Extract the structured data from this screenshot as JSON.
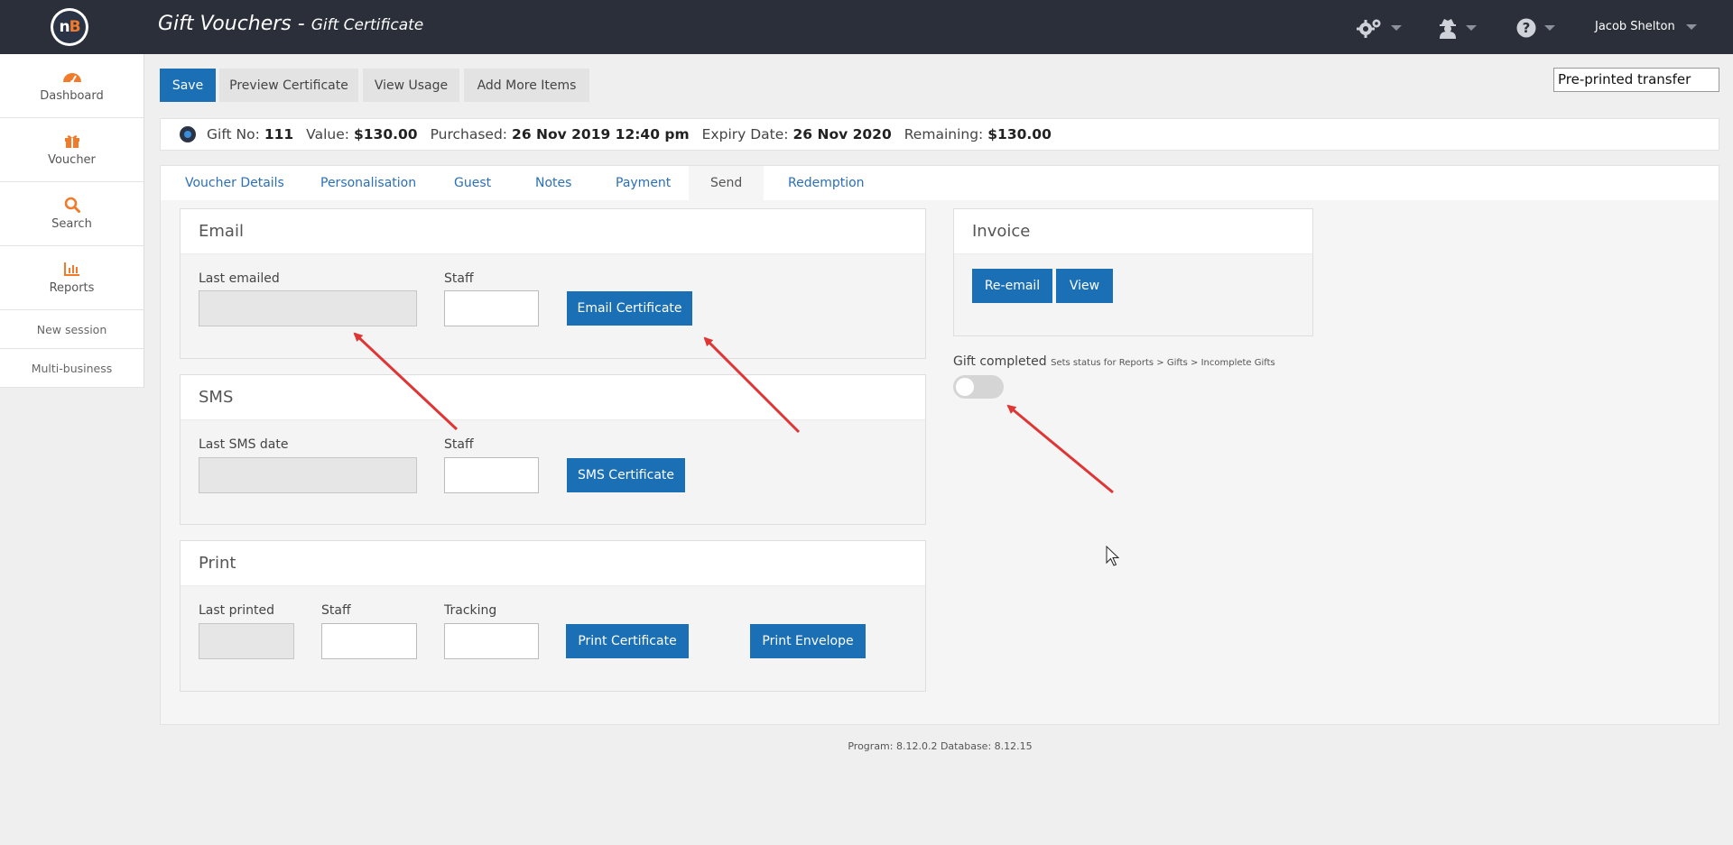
{
  "header": {
    "logo_text": "nB",
    "title": "Gift Vouchers",
    "separator": " - ",
    "subtitle": "Gift Certificate",
    "user_name": "Jacob Shelton"
  },
  "sidebar": {
    "items": [
      {
        "label": "Dashboard",
        "icon": "dashboard-icon"
      },
      {
        "label": "Voucher",
        "icon": "gift-icon"
      },
      {
        "label": "Search",
        "icon": "search-icon"
      },
      {
        "label": "Reports",
        "icon": "bar-chart-icon"
      }
    ],
    "links": [
      "New session",
      "Multi-business"
    ]
  },
  "toolbar": {
    "save": "Save",
    "preview": "Preview Certificate",
    "usage": "View Usage",
    "add_items": "Add More Items",
    "delivery_select": "Pre-printed transfer"
  },
  "info": {
    "gift_no_label": "Gift No:",
    "gift_no": "111",
    "value_label": "Value:",
    "value": "$130.00",
    "purchased_label": "Purchased:",
    "purchased": "26 Nov 2019 12:40 pm",
    "expiry_label": "Expiry Date:",
    "expiry": "26 Nov 2020",
    "remaining_label": "Remaining:",
    "remaining": "$130.00"
  },
  "tabs": [
    "Voucher Details",
    "Personalisation",
    "Guest",
    "Notes",
    "Payment",
    "Send",
    "Redemption"
  ],
  "active_tab": "Send",
  "email": {
    "title": "Email",
    "last_label": "Last emailed",
    "last_value": "",
    "staff_label": "Staff",
    "staff_value": "",
    "button": "Email Certificate"
  },
  "sms": {
    "title": "SMS",
    "last_label": "Last SMS date",
    "last_value": "",
    "staff_label": "Staff",
    "staff_value": "",
    "button": "SMS Certificate"
  },
  "print": {
    "title": "Print",
    "last_label": "Last printed",
    "staff_label": "Staff",
    "tracking_label": "Tracking",
    "print_button": "Print Certificate",
    "envelope_button": "Print Envelope"
  },
  "invoice": {
    "title": "Invoice",
    "reemail": "Re-email",
    "view": "View"
  },
  "gift_completed": {
    "label": "Gift completed",
    "hint": "Sets status for Reports > Gifts > Incomplete Gifts",
    "checked": false
  },
  "footer": {
    "version": "Program: 8.12.0.2 Database: 8.12.15"
  },
  "colors": {
    "header_bg": "#2b2f3a",
    "accent_blue": "#1a6fb5",
    "link_blue": "#2a6fb8",
    "brand_orange": "#f07b2b",
    "annotation_red": "#e03535"
  }
}
